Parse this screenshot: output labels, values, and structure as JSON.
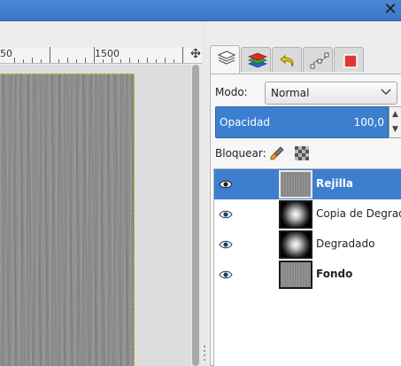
{
  "window": {
    "close_icon": "close-icon",
    "close_glyph": "✕"
  },
  "ruler": {
    "labels": [
      "50",
      "1500"
    ]
  },
  "colors": {
    "selection": "#3d7fcf",
    "title_bar": "#4a87d6",
    "selection_border": "#d4c000"
  },
  "dock": {
    "tabs": [
      {
        "icon": "layers-icon",
        "active": true
      },
      {
        "icon": "channels-icon",
        "active": false
      },
      {
        "icon": "undo-history-icon",
        "active": false
      },
      {
        "icon": "paths-icon",
        "active": false
      },
      {
        "icon": "color-stop-icon",
        "active": false
      }
    ],
    "menu_icon": "tab-menu-icon",
    "menu_glyph": "◀"
  },
  "layers_panel": {
    "mode_label": "Modo:",
    "mode_value": "Normal",
    "opacity_label": "Opacidad",
    "opacity_value": "100,0",
    "lock_label": "Bloquear:",
    "lock_icons": [
      "lock-paint-icon",
      "lock-alpha-icon"
    ],
    "layers": [
      {
        "name": "Rejilla",
        "bold": true,
        "selected": true,
        "thumb": "noise",
        "visible": true
      },
      {
        "name": "Copia de Degradado",
        "bold": false,
        "selected": false,
        "thumb": "gradient",
        "visible": true
      },
      {
        "name": "Degradado",
        "bold": false,
        "selected": false,
        "thumb": "gradient",
        "visible": true
      },
      {
        "name": "Fondo",
        "bold": true,
        "selected": false,
        "thumb": "noise",
        "visible": true
      }
    ]
  }
}
